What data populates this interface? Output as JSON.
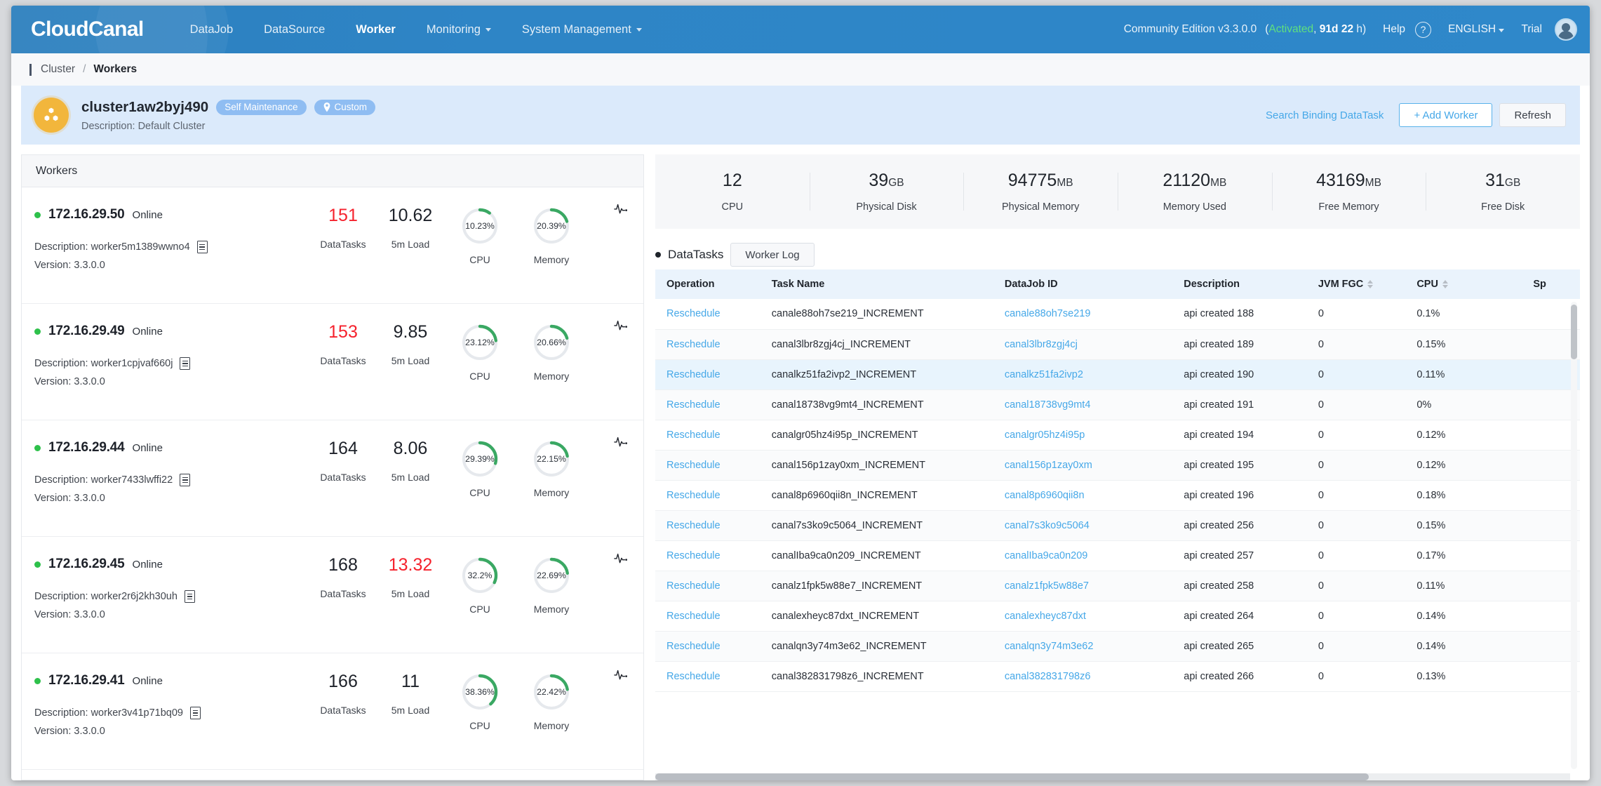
{
  "nav": {
    "logo": "CloudCanal",
    "items": [
      {
        "label": "DataJob",
        "dropdown": false,
        "active": false
      },
      {
        "label": "DataSource",
        "dropdown": false,
        "active": false
      },
      {
        "label": "Worker",
        "dropdown": false,
        "active": true
      },
      {
        "label": "Monitoring",
        "dropdown": true,
        "active": false
      },
      {
        "label": "System Management",
        "dropdown": true,
        "active": false
      }
    ],
    "edition": "Community Edition v3.3.0.0",
    "license_prefix": "(",
    "license_state": "Activated",
    "license_mid": ", ",
    "license_days": "91d",
    "license_d_unit": " ",
    "license_hours": "22",
    "license_h_unit": " h)",
    "help": "Help",
    "help_icon": "question-circle-icon",
    "language": "ENGLISH",
    "trial": "Trial",
    "avatar_icon": "user-avatar"
  },
  "breadcrumb": {
    "parent": "Cluster",
    "separator": "/",
    "current": "Workers"
  },
  "cluster": {
    "icon": "cluster-cube-icon",
    "name": "cluster1aw2byj490",
    "tags": [
      {
        "label": "Self Maintenance",
        "icon": ""
      },
      {
        "label": "Custom",
        "icon": "location-pin-icon"
      }
    ],
    "description": "Description: Default Cluster",
    "search_binding_datatask": "Search Binding DataTask",
    "add_worker": "+ Add Worker",
    "refresh": "Refresh"
  },
  "workers_panel": {
    "title": "Workers",
    "metric_labels": {
      "datatasks": "DataTasks",
      "load": "5m Load",
      "cpu": "CPU",
      "memory": "Memory"
    },
    "items": [
      {
        "ip": "172.16.29.50",
        "status": "Online",
        "datatasks": "151",
        "datatasks_alert": true,
        "load": "10.62",
        "load_alert": false,
        "cpu": "10.23%",
        "cpu_value": 10.23,
        "memory": "20.39%",
        "memory_value": 20.39,
        "description": "Description: worker5m1389wwno4",
        "version": "Version: 3.3.0.0"
      },
      {
        "ip": "172.16.29.49",
        "status": "Online",
        "datatasks": "153",
        "datatasks_alert": true,
        "load": "9.85",
        "load_alert": false,
        "cpu": "23.12%",
        "cpu_value": 23.12,
        "memory": "20.66%",
        "memory_value": 20.66,
        "description": "Description: worker1cpjvaf660j",
        "version": "Version: 3.3.0.0"
      },
      {
        "ip": "172.16.29.44",
        "status": "Online",
        "datatasks": "164",
        "datatasks_alert": false,
        "load": "8.06",
        "load_alert": false,
        "cpu": "29.39%",
        "cpu_value": 29.39,
        "memory": "22.15%",
        "memory_value": 22.15,
        "description": "Description: worker7433lwffi22",
        "version": "Version: 3.3.0.0"
      },
      {
        "ip": "172.16.29.45",
        "status": "Online",
        "datatasks": "168",
        "datatasks_alert": false,
        "load": "13.32",
        "load_alert": true,
        "cpu": "32.2%",
        "cpu_value": 32.2,
        "memory": "22.69%",
        "memory_value": 22.69,
        "description": "Description: worker2r6j2kh30uh",
        "version": "Version: 3.3.0.0"
      },
      {
        "ip": "172.16.29.41",
        "status": "Online",
        "datatasks": "166",
        "datatasks_alert": false,
        "load": "11",
        "load_alert": false,
        "cpu": "38.36%",
        "cpu_value": 38.36,
        "memory": "22.42%",
        "memory_value": 22.42,
        "description": "Description: worker3v41p71bq09",
        "version": "Version: 3.3.0.0"
      }
    ]
  },
  "stats": [
    {
      "value": "12",
      "unit": "",
      "caption": "CPU"
    },
    {
      "value": "39",
      "unit": "GB",
      "caption": "Physical Disk"
    },
    {
      "value": "94775",
      "unit": "MB",
      "caption": "Physical Memory"
    },
    {
      "value": "21120",
      "unit": "MB",
      "caption": "Memory Used"
    },
    {
      "value": "43169",
      "unit": "MB",
      "caption": "Free Memory"
    },
    {
      "value": "31",
      "unit": "GB",
      "caption": "Free Disk"
    }
  ],
  "datatasks": {
    "title": "DataTasks",
    "worker_log": "Worker Log",
    "columns": [
      {
        "label": "Operation",
        "sortable": false
      },
      {
        "label": "Task Name",
        "sortable": false
      },
      {
        "label": "DataJob ID",
        "sortable": false
      },
      {
        "label": "Description",
        "sortable": false
      },
      {
        "label": "JVM FGC",
        "sortable": true
      },
      {
        "label": "CPU",
        "sortable": true
      },
      {
        "label": "Sp",
        "sortable": false
      }
    ],
    "rows": [
      {
        "operation": "Reschedule",
        "task_name": "canale88oh7se219_INCREMENT",
        "datajob_id": "canale88oh7se219",
        "description": "api created 188",
        "jvm_fgc": "0",
        "cpu": "0.1%",
        "hover": false
      },
      {
        "operation": "Reschedule",
        "task_name": "canal3lbr8zgj4cj_INCREMENT",
        "datajob_id": "canal3lbr8zgj4cj",
        "description": "api created 189",
        "jvm_fgc": "0",
        "cpu": "0.15%",
        "hover": false
      },
      {
        "operation": "Reschedule",
        "task_name": "canalkz51fa2ivp2_INCREMENT",
        "datajob_id": "canalkz51fa2ivp2",
        "description": "api created 190",
        "jvm_fgc": "0",
        "cpu": "0.11%",
        "hover": true
      },
      {
        "operation": "Reschedule",
        "task_name": "canal18738vg9mt4_INCREMENT",
        "datajob_id": "canal18738vg9mt4",
        "description": "api created 191",
        "jvm_fgc": "0",
        "cpu": "0%",
        "hover": false
      },
      {
        "operation": "Reschedule",
        "task_name": "canalgr05hz4i95p_INCREMENT",
        "datajob_id": "canalgr05hz4i95p",
        "description": "api created 194",
        "jvm_fgc": "0",
        "cpu": "0.12%",
        "hover": false
      },
      {
        "operation": "Reschedule",
        "task_name": "canal156p1zay0xm_INCREMENT",
        "datajob_id": "canal156p1zay0xm",
        "description": "api created 195",
        "jvm_fgc": "0",
        "cpu": "0.12%",
        "hover": false
      },
      {
        "operation": "Reschedule",
        "task_name": "canal8p6960qii8n_INCREMENT",
        "datajob_id": "canal8p6960qii8n",
        "description": "api created 196",
        "jvm_fgc": "0",
        "cpu": "0.18%",
        "hover": false
      },
      {
        "operation": "Reschedule",
        "task_name": "canal7s3ko9c5064_INCREMENT",
        "datajob_id": "canal7s3ko9c5064",
        "description": "api created 256",
        "jvm_fgc": "0",
        "cpu": "0.15%",
        "hover": false
      },
      {
        "operation": "Reschedule",
        "task_name": "canalIba9ca0n209_INCREMENT",
        "datajob_id": "canalIba9ca0n209",
        "description": "api created 257",
        "jvm_fgc": "0",
        "cpu": "0.17%",
        "hover": false
      },
      {
        "operation": "Reschedule",
        "task_name": "canalz1fpk5w88e7_INCREMENT",
        "datajob_id": "canalz1fpk5w88e7",
        "description": "api created 258",
        "jvm_fgc": "0",
        "cpu": "0.11%",
        "hover": false
      },
      {
        "operation": "Reschedule",
        "task_name": "canalexheyc87dxt_INCREMENT",
        "datajob_id": "canalexheyc87dxt",
        "description": "api created 264",
        "jvm_fgc": "0",
        "cpu": "0.14%",
        "hover": false
      },
      {
        "operation": "Reschedule",
        "task_name": "canalqn3y74m3e62_INCREMENT",
        "datajob_id": "canalqn3y74m3e62",
        "description": "api created 265",
        "jvm_fgc": "0",
        "cpu": "0.14%",
        "hover": false
      },
      {
        "operation": "Reschedule",
        "task_name": "canal382831798z6_INCREMENT",
        "datajob_id": "canal382831798z6",
        "description": "api created 266",
        "jvm_fgc": "0",
        "cpu": "0.13%",
        "hover": false
      }
    ]
  },
  "colors": {
    "nav_blue": "#2e86c8",
    "accent_link": "#46a8e8",
    "gauge_green": "#3aa863",
    "alert_red": "#f5222d",
    "cluster_bg": "#dbeafb",
    "tag_blue": "#8fbdf2",
    "cluster_icon": "#f2b63c"
  }
}
